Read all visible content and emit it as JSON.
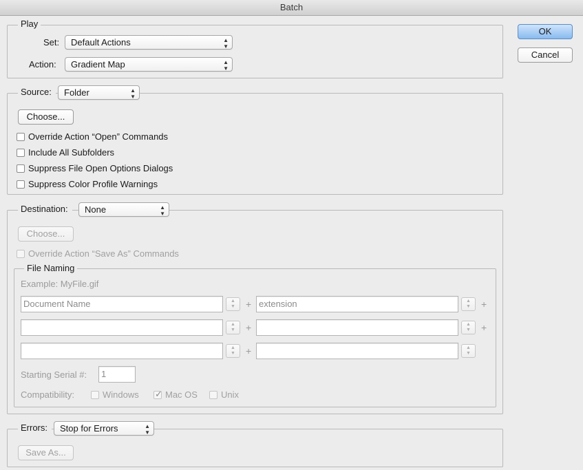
{
  "window": {
    "title": "Batch"
  },
  "buttons": {
    "ok": "OK",
    "cancel": "Cancel"
  },
  "play": {
    "legend": "Play",
    "set_label": "Set:",
    "set_value": "Default Actions",
    "action_label": "Action:",
    "action_value": "Gradient Map"
  },
  "source": {
    "label": "Source:",
    "value": "Folder",
    "choose": "Choose...",
    "options": [
      {
        "label": "Override Action “Open” Commands",
        "checked": false
      },
      {
        "label": "Include All Subfolders",
        "checked": false
      },
      {
        "label": "Suppress File Open Options Dialogs",
        "checked": false
      },
      {
        "label": "Suppress Color Profile Warnings",
        "checked": false
      }
    ]
  },
  "destination": {
    "label": "Destination:",
    "value": "None",
    "choose": "Choose...",
    "override": {
      "label": "Override Action “Save As” Commands",
      "checked": false
    },
    "file_naming": {
      "legend": "File Naming",
      "example": "Example: MyFile.gif",
      "rows": [
        {
          "left": "Document Name",
          "right": "extension"
        },
        {
          "left": "",
          "right": ""
        },
        {
          "left": "",
          "right": ""
        }
      ],
      "serial_label": "Starting Serial #:",
      "serial_value": "1",
      "compat_label": "Compatibility:",
      "compat": [
        {
          "label": "Windows",
          "checked": false
        },
        {
          "label": "Mac OS",
          "checked": true
        },
        {
          "label": "Unix",
          "checked": false
        }
      ]
    }
  },
  "errors": {
    "label": "Errors:",
    "value": "Stop for Errors",
    "save_as": "Save As..."
  },
  "colors": {
    "accent": "#88baf0",
    "disabled_text": "#a0a0a0"
  }
}
